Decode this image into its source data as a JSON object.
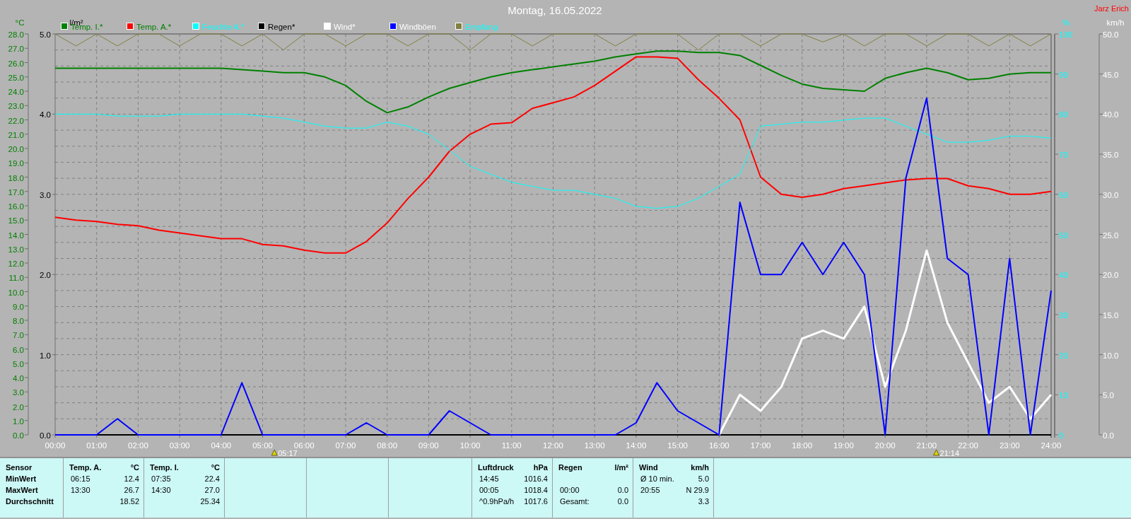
{
  "title": "Montag, 16.05.2022",
  "author": "Jarz Erich",
  "chart_data": {
    "type": "line",
    "xlim": [
      0,
      24
    ],
    "x": [
      0,
      0.5,
      1,
      1.5,
      2,
      2.5,
      3,
      3.5,
      4,
      4.5,
      5,
      5.5,
      6,
      6.5,
      7,
      7.5,
      8,
      8.5,
      9,
      9.5,
      10,
      10.5,
      11,
      11.5,
      12,
      12.5,
      13,
      13.5,
      14,
      14.5,
      15,
      15.5,
      16,
      16.5,
      17,
      17.5,
      18,
      18.5,
      19,
      19.5,
      20,
      20.5,
      21,
      21.5,
      22,
      22.5,
      23,
      23.5,
      24
    ],
    "xticks": [
      {
        "value": 0,
        "label": "00:00"
      },
      {
        "value": 1,
        "label": "01:00"
      },
      {
        "value": 2,
        "label": "02:00"
      },
      {
        "value": 3,
        "label": "03:00"
      },
      {
        "value": 4,
        "label": "04:00"
      },
      {
        "value": 5,
        "label": "05:00"
      },
      {
        "value": 6,
        "label": "06:00"
      },
      {
        "value": 7,
        "label": "07:00"
      },
      {
        "value": 8,
        "label": "08:00"
      },
      {
        "value": 9,
        "label": "09:00"
      },
      {
        "value": 10,
        "label": "10:00"
      },
      {
        "value": 11,
        "label": "11:00"
      },
      {
        "value": 12,
        "label": "12:00"
      },
      {
        "value": 13,
        "label": "13:00"
      },
      {
        "value": 14,
        "label": "14:00"
      },
      {
        "value": 15,
        "label": "15:00"
      },
      {
        "value": 16,
        "label": "16:00"
      },
      {
        "value": 17,
        "label": "17:00"
      },
      {
        "value": 18,
        "label": "18:00"
      },
      {
        "value": 19,
        "label": "19:00"
      },
      {
        "value": 20,
        "label": "20:00"
      },
      {
        "value": 21,
        "label": "21:00"
      },
      {
        "value": 22,
        "label": "22:00"
      },
      {
        "value": 23,
        "label": "23:00"
      },
      {
        "value": 24,
        "label": "24:00"
      }
    ],
    "ylabel": "°C",
    "ylim": [
      0,
      28
    ],
    "yticks": [
      {
        "value": 0,
        "label": "0.0"
      },
      {
        "value": 1,
        "label": "1.0"
      },
      {
        "value": 2,
        "label": "2.0"
      },
      {
        "value": 3,
        "label": "3.0"
      },
      {
        "value": 4,
        "label": "4.0"
      },
      {
        "value": 5,
        "label": "5.0"
      },
      {
        "value": 6,
        "label": "6.0"
      },
      {
        "value": 7,
        "label": "7.0"
      },
      {
        "value": 8,
        "label": "8.0"
      },
      {
        "value": 9,
        "label": "9.0"
      },
      {
        "value": 10,
        "label": "10.0"
      },
      {
        "value": 11,
        "label": "11.0"
      },
      {
        "value": 12,
        "label": "12.0"
      },
      {
        "value": 13,
        "label": "13.0"
      },
      {
        "value": 14,
        "label": "14.0"
      },
      {
        "value": 15,
        "label": "15.0"
      },
      {
        "value": 16,
        "label": "16.0"
      },
      {
        "value": 17,
        "label": "17.0"
      },
      {
        "value": 18,
        "label": "18.0"
      },
      {
        "value": 19,
        "label": "19.0"
      },
      {
        "value": 20,
        "label": "20.0"
      },
      {
        "value": 21,
        "label": "21.0"
      },
      {
        "value": 22,
        "label": "22.0"
      },
      {
        "value": 23,
        "label": "23.0"
      },
      {
        "value": 24,
        "label": "24.0"
      },
      {
        "value": 25,
        "label": "25.0"
      },
      {
        "value": 26,
        "label": "26.0"
      },
      {
        "value": 27,
        "label": "27.0"
      },
      {
        "value": 28,
        "label": "28.0"
      }
    ],
    "y2label": "%",
    "y2lim": [
      0,
      100
    ],
    "y2ticks": [
      0,
      10,
      20,
      30,
      40,
      50,
      60,
      70,
      80,
      90,
      100
    ],
    "y3label": "km/h",
    "y3lim": [
      0,
      50
    ],
    "y3ticks": [
      {
        "value": 0,
        "label": "0.0"
      },
      {
        "value": 5,
        "label": "5.0"
      },
      {
        "value": 10,
        "label": "10.0"
      },
      {
        "value": 15,
        "label": "15.0"
      },
      {
        "value": 20,
        "label": "20.0"
      },
      {
        "value": 25,
        "label": "25.0"
      },
      {
        "value": 30,
        "label": "30.0"
      },
      {
        "value": 35,
        "label": "35.0"
      },
      {
        "value": 40,
        "label": "40.0"
      },
      {
        "value": 45,
        "label": "45.0"
      },
      {
        "value": 50,
        "label": "50.0"
      }
    ],
    "series": [
      {
        "name": "Temp. I.*",
        "color": "#008000",
        "values": [
          25.6,
          25.6,
          25.6,
          25.6,
          25.6,
          25.6,
          25.6,
          25.6,
          25.6,
          25.5,
          25.4,
          25.3,
          25.3,
          25.0,
          24.4,
          23.3,
          22.5,
          22.9,
          23.6,
          24.2,
          24.6,
          25.0,
          25.3,
          25.5,
          25.7,
          25.9,
          26.1,
          26.4,
          26.6,
          26.8,
          26.8,
          26.7,
          26.7,
          26.5,
          25.8,
          25.1,
          24.5,
          24.2,
          24.1,
          24.0,
          24.9,
          25.3,
          25.6,
          25.3,
          24.8,
          24.9,
          25.2,
          25.3,
          25.3
        ]
      },
      {
        "name": "Temp. A.*",
        "color": "#ff0000",
        "values": [
          15.2,
          15.0,
          14.9,
          14.7,
          14.6,
          14.3,
          14.1,
          13.9,
          13.7,
          13.7,
          13.3,
          13.2,
          12.9,
          12.7,
          12.7,
          13.5,
          14.8,
          16.5,
          18.0,
          19.8,
          21.0,
          21.7,
          21.8,
          22.8,
          23.2,
          23.6,
          24.4,
          25.4,
          26.4,
          26.4,
          26.3,
          24.8,
          23.5,
          22.0,
          18.0,
          16.8,
          16.6,
          16.8,
          17.2,
          17.4,
          17.6,
          17.8,
          17.9,
          17.9,
          17.4,
          17.2,
          16.8,
          16.8,
          17.0
        ]
      },
      {
        "name": "Feuchte A.*",
        "color": "#00ffff",
        "axis": "y2",
        "values": [
          80,
          80,
          80,
          79.5,
          79.5,
          79.5,
          80,
          80,
          80,
          80,
          79.5,
          79,
          78,
          77,
          76.5,
          76.5,
          78,
          77,
          75,
          71,
          67,
          65,
          63,
          62,
          61,
          61,
          60,
          59,
          57,
          56.5,
          57,
          59,
          62,
          65,
          77,
          77.5,
          78,
          78,
          78.5,
          79,
          79,
          77,
          75,
          73,
          73,
          73.5,
          74.5,
          74.5,
          74
        ]
      },
      {
        "name": "Regen*",
        "color": "#000000",
        "values": [
          0,
          0,
          0,
          0,
          0,
          0,
          0,
          0,
          0,
          0,
          0,
          0,
          0,
          0,
          0,
          0,
          0,
          0,
          0,
          0,
          0,
          0,
          0,
          0,
          0,
          0,
          0,
          0,
          0,
          0,
          0,
          0,
          0,
          0,
          0,
          0,
          0,
          0,
          0,
          0,
          0,
          0,
          0,
          0,
          0,
          0,
          0,
          0,
          0
        ]
      },
      {
        "name": "Wind*",
        "color": "#ffffff",
        "axis": "y3",
        "values": [
          null,
          null,
          null,
          null,
          null,
          null,
          null,
          null,
          null,
          null,
          null,
          null,
          null,
          null,
          null,
          null,
          null,
          null,
          null,
          null,
          null,
          null,
          null,
          null,
          null,
          null,
          null,
          null,
          null,
          null,
          null,
          null,
          0,
          5,
          3,
          6,
          12,
          13,
          12,
          16,
          6,
          13,
          23,
          14,
          9,
          4,
          6,
          2,
          5
        ]
      },
      {
        "name": "Windböen",
        "color": "#0000ff",
        "axis": "y3",
        "values": [
          0,
          0,
          0,
          2,
          0,
          0,
          0,
          0,
          0,
          6.5,
          0,
          0,
          0,
          0,
          0,
          1.5,
          0,
          0,
          0,
          3,
          1.5,
          0,
          0,
          0,
          0,
          0,
          0,
          0,
          1.5,
          6.5,
          3,
          1.5,
          0,
          29,
          20,
          20,
          24,
          20,
          24,
          20,
          0,
          32,
          42,
          22,
          20,
          0,
          22,
          0,
          18
        ]
      },
      {
        "name": "Empfang",
        "color": "#808040",
        "axis": "y2",
        "values": [
          100,
          97,
          100,
          97,
          100,
          100,
          97,
          100,
          100,
          97,
          100,
          96,
          100,
          100,
          97,
          100,
          100,
          97,
          100,
          100,
          96,
          100,
          100,
          97,
          100,
          100,
          100,
          97,
          100,
          100,
          100,
          96,
          100,
          100,
          97,
          100,
          100,
          98,
          100,
          97,
          100,
          100,
          97,
          100,
          100,
          97,
          100,
          97,
          100
        ]
      }
    ],
    "grid": true,
    "legend": "top",
    "annotations": [
      "05:17",
      "21:14"
    ]
  },
  "rain_axis": {
    "unit": "l/m²",
    "ticks": [
      "5.0",
      "4.0",
      "3.0",
      "2.0",
      "1.0",
      "0.0"
    ]
  },
  "summary": {
    "row_labels": [
      "Sensor",
      "MinWert",
      "MaxWert",
      "Durchschnitt"
    ],
    "sections": [
      {
        "kind": "data",
        "title": "Temp. A.",
        "unit": "°C",
        "rows": [
          {
            "label": "06:15",
            "value": "12.4"
          },
          {
            "label": "13:30",
            "value": "26.7"
          },
          {
            "value": "18.52"
          }
        ]
      },
      {
        "kind": "data",
        "title": "Temp. I.",
        "unit": "°C",
        "rows": [
          {
            "label": "07:35",
            "value": "22.4"
          },
          {
            "label": "14:30",
            "value": "27.0"
          },
          {
            "value": "25.34"
          }
        ]
      },
      {
        "kind": "blank"
      },
      {
        "kind": "blank"
      },
      {
        "kind": "blank"
      },
      {
        "kind": "data",
        "title": "Luftdruck",
        "unit": "hPa",
        "rows": [
          {
            "label": "14:45",
            "value": "1016.4"
          },
          {
            "label": "00:05",
            "value": "1018.4"
          },
          {
            "label": "^0.9hPa/h",
            "value": "1017.6"
          }
        ]
      },
      {
        "kind": "data",
        "title": "Regen",
        "unit": "l/m²",
        "rows": [
          {},
          {
            "label": "00:00",
            "value": "0.0"
          },
          {
            "label": "Gesamt:",
            "value": "0.0"
          }
        ]
      },
      {
        "kind": "data",
        "title": "Wind",
        "unit": "km/h",
        "rows": [
          {
            "label": "Ø 10 min.",
            "value": "5.0"
          },
          {
            "label": "20:55",
            "value": "N 29.9"
          },
          {
            "value": "3.3"
          }
        ]
      },
      {
        "kind": "filler"
      }
    ]
  }
}
